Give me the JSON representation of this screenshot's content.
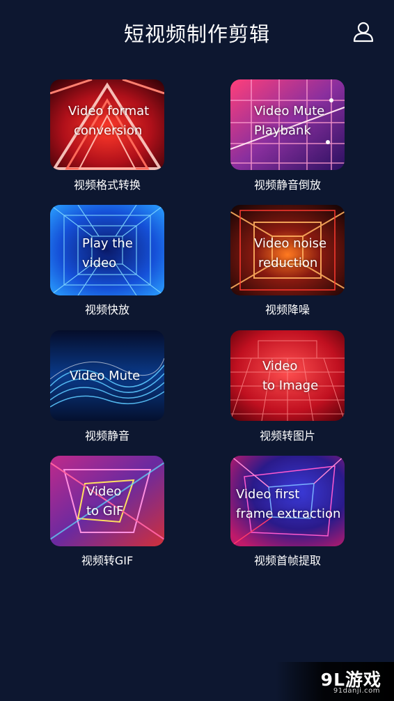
{
  "header": {
    "title": "短视频制作剪辑",
    "user_icon": "user-icon"
  },
  "features": [
    {
      "en_line1": "Video format",
      "en_line2": "conversion",
      "label": "视频格式转换",
      "theme": "red-triangle"
    },
    {
      "en_line1": "Video Mute",
      "en_line2": "Playbank",
      "label": "视频静音倒放",
      "theme": "pink-grid"
    },
    {
      "en_line1": "Play the",
      "en_line2": "video",
      "label": "视频快放",
      "theme": "blue-tunnel"
    },
    {
      "en_line1": "Video noise",
      "en_line2": "reduction",
      "label": "视频降噪",
      "theme": "orange-corridor"
    },
    {
      "en_line1": "Video Mute",
      "en_line2": "",
      "label": "视频静音",
      "theme": "blue-waves"
    },
    {
      "en_line1": "Video",
      "en_line2": "to Image",
      "label": "视频转图片",
      "theme": "red-grid"
    },
    {
      "en_line1": "Video",
      "en_line2": "to GIF",
      "label": "视频转GIF",
      "theme": "pink-neon"
    },
    {
      "en_line1": "Video first",
      "en_line2": "frame extraction",
      "label": "视频首帧提取",
      "theme": "purple-tunnel"
    }
  ],
  "watermark": {
    "logo": "9L游戏",
    "url": "91danji.com"
  },
  "colors": {
    "background": "#0d1730",
    "text": "#ffffff"
  }
}
